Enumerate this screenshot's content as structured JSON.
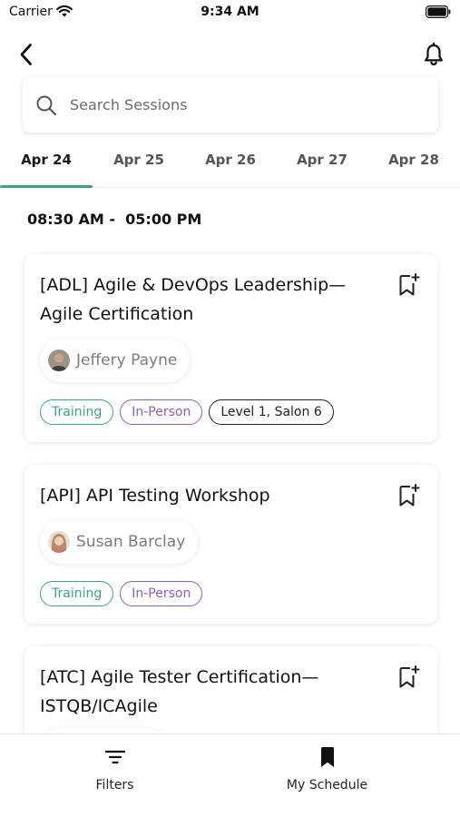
{
  "status_bar": {
    "carrier": "Carrier",
    "time": "9:34 AM"
  },
  "nav": {
    "back_icon": "chevron-left-icon",
    "notification_icon": "bell-icon"
  },
  "search": {
    "placeholder": "Search Sessions",
    "value": "",
    "icon": "search-icon"
  },
  "date_tabs": [
    {
      "label": "Apr 24",
      "active": true
    },
    {
      "label": "Apr 25",
      "active": false
    },
    {
      "label": "Apr 26",
      "active": false
    },
    {
      "label": "Apr 27",
      "active": false
    },
    {
      "label": "Apr 28",
      "active": false
    }
  ],
  "time_range": "08:30 AM -  05:00 PM",
  "sessions": [
    {
      "title": "[ADL] Agile & DevOps Leadership—Agile Certification",
      "speaker": "Jeffery Payne",
      "tags": [
        {
          "label": "Training",
          "color": "#3aa57f"
        },
        {
          "label": "In-Person",
          "color": "#8e5fb3"
        },
        {
          "label": "Level 1, Salon 6",
          "color": "#222222"
        }
      ]
    },
    {
      "title": "[API] API Testing Workshop",
      "speaker": "Susan Barclay",
      "tags": [
        {
          "label": "Training",
          "color": "#3aa57f"
        },
        {
          "label": "In-Person",
          "color": "#8e5fb3"
        }
      ]
    },
    {
      "title": "[ATC] Agile Tester Certification—ISTQB/ICAgile",
      "speaker": "",
      "tags": []
    }
  ],
  "bottom_nav": [
    {
      "label": "Filters",
      "icon": "filter-icon"
    },
    {
      "label": "My Schedule",
      "icon": "bookmark-icon"
    }
  ],
  "colors": {
    "accent": "#3aa57f",
    "in_person": "#8e5fb3",
    "text": "#111111"
  }
}
